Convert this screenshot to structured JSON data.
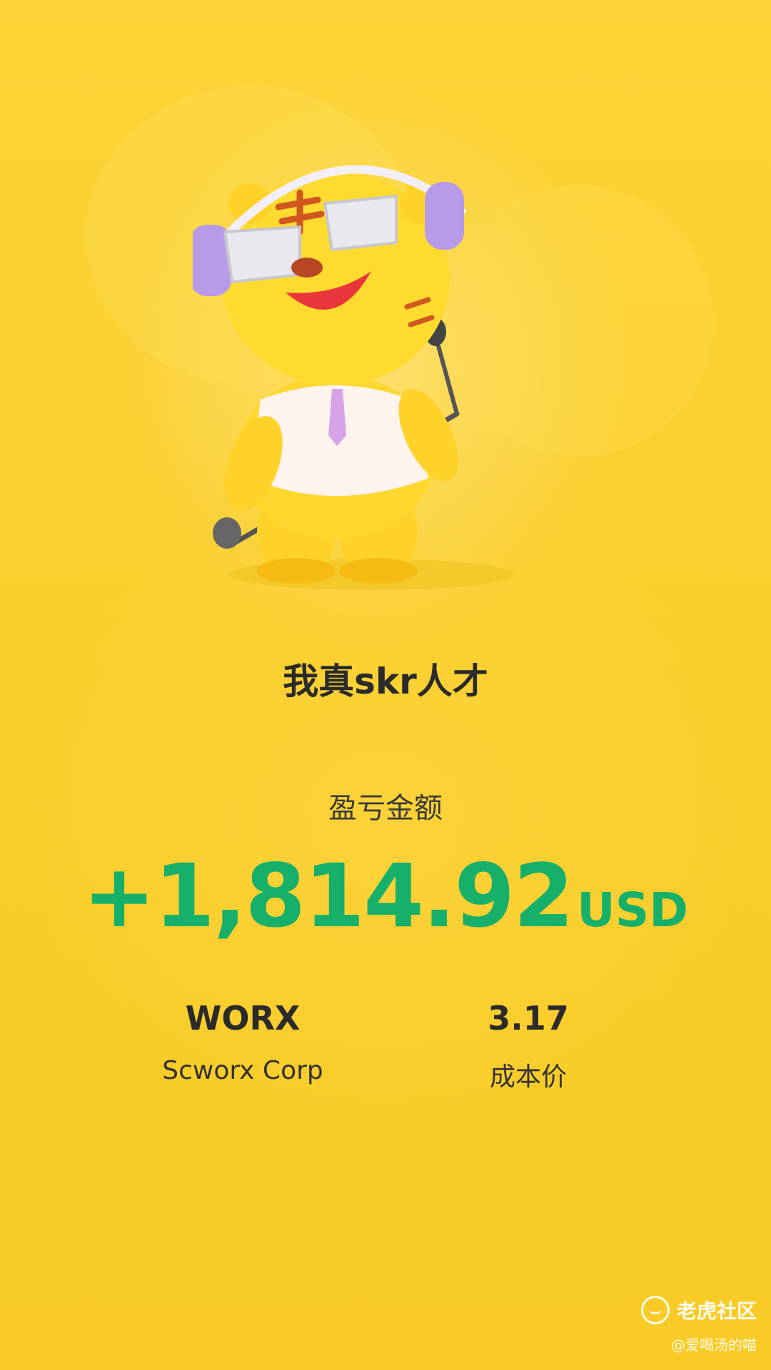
{
  "mascot": {
    "icon": "singing-tiger-mascot-icon"
  },
  "headline": "我真skr人才",
  "pl": {
    "label": "盈亏金额",
    "amount": "+1,814.92",
    "currency": "USD",
    "color": "#17b06a"
  },
  "stock": {
    "symbol": "WORX",
    "name": "Scworx Corp"
  },
  "cost": {
    "value": "3.17",
    "label": "成本价"
  },
  "watermark": {
    "brand": "老虎社区",
    "user": "@爱喝汤的喵"
  },
  "colors": {
    "background": "#f9cf2e",
    "text_dark": "#2b2b2b"
  }
}
